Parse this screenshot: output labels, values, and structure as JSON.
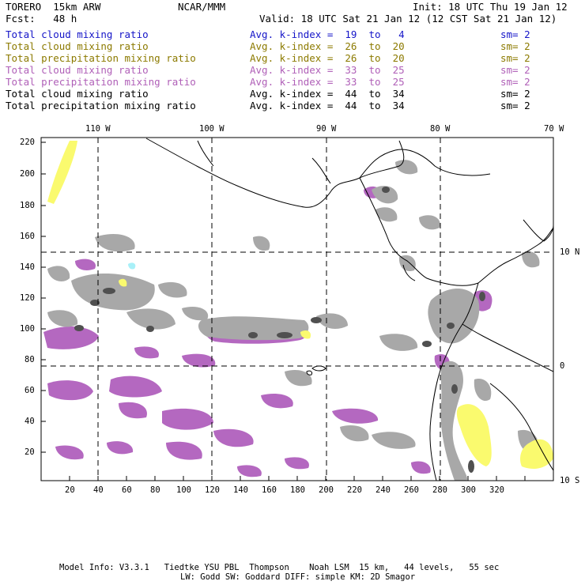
{
  "header": {
    "model_name": "TORERO  15km ARW",
    "org": "NCAR/MMM",
    "init": "Init: 18 UTC Thu 19 Jan 12",
    "fcst": "Fcst:   48 h",
    "valid": "Valid: 18 UTC Sat 21 Jan 12 (12 CST Sat 21 Jan 12)"
  },
  "legend_rows": [
    {
      "field": "Total cloud mixing ratio",
      "kindex": "Avg. k-index =  19  to   4",
      "sm": "sm= 2",
      "color": "#1515c8"
    },
    {
      "field": "Total cloud mixing ratio",
      "kindex": "Avg. k-index =  26  to  20",
      "sm": "sm= 2",
      "color": "#8c7a00"
    },
    {
      "field": "Total precipitation mixing ratio",
      "kindex": "Avg. k-index =  26  to  20",
      "sm": "sm= 2",
      "color": "#8c7a00"
    },
    {
      "field": "Total cloud mixing ratio",
      "kindex": "Avg. k-index =  33  to  25",
      "sm": "sm= 2",
      "color": "#b060b8"
    },
    {
      "field": "Total precipitation mixing ratio",
      "kindex": "Avg. k-index =  33  to  25",
      "sm": "sm= 2",
      "color": "#b060b8"
    },
    {
      "field": "Total cloud mixing ratio",
      "kindex": "Avg. k-index =  44  to  34",
      "sm": "sm= 2",
      "color": "#000000"
    },
    {
      "field": "Total precipitation mixing ratio",
      "kindex": "Avg. k-index =  44  to  34",
      "sm": "sm= 2",
      "color": "#000000"
    }
  ],
  "map": {
    "lon_labels": [
      "110 W",
      "100 W",
      "90 W",
      "80 W",
      "70 W"
    ],
    "lat_labels": [
      "10 N",
      "0",
      "10 S"
    ],
    "x_ticks": [
      "20",
      "40",
      "60",
      "80",
      "100",
      "120",
      "140",
      "160",
      "180",
      "200",
      "220",
      "240",
      "260",
      "280",
      "300",
      "320"
    ],
    "y_ticks": [
      "220",
      "200",
      "180",
      "160",
      "140",
      "120",
      "100",
      "80",
      "60",
      "40",
      "20"
    ],
    "colors": {
      "gray": "#a8a8a8",
      "dark_gray": "#505050",
      "purple": "#b468c0",
      "yellow": "#fafa6e",
      "cyan": "#a8f0f8",
      "coast": "#000000"
    }
  },
  "footer": {
    "line1": "Model Info: V3.3.1   Tiedtke YSU PBL  Thompson    Noah LSM  15 km,   44 levels,   55 sec",
    "line2": "LW: Godd SW: Goddard DIFF: simple KM: 2D Smagor"
  }
}
